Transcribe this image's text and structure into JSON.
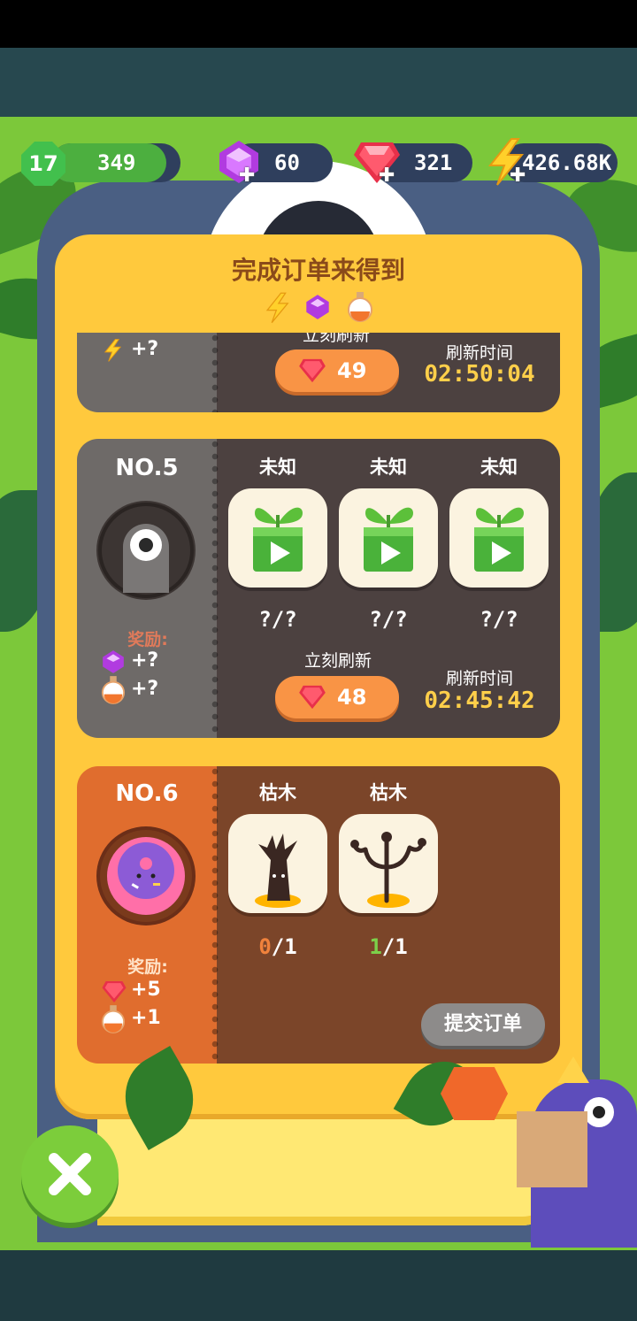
{
  "hud": {
    "level": "17",
    "xp": "349",
    "xp_fraction": 0.78,
    "gems": "60",
    "rubies": "321",
    "energy": "426.68K"
  },
  "panel": {
    "title": "完成订单来得到",
    "title_icons": [
      "lightning-icon",
      "purple-gem-icon",
      "potion-icon"
    ]
  },
  "order4": {
    "reward_value": "+?",
    "refresh_label": "立刻刷新",
    "refresh_cost": "49",
    "time_label": "刷新时间",
    "time_value": "02:50:04"
  },
  "order5": {
    "number": "NO.5",
    "reward_label": "奖励:",
    "rewards": [
      {
        "icon": "purple-gem-icon",
        "value": "+?"
      },
      {
        "icon": "potion-icon",
        "value": "+?"
      }
    ],
    "items": [
      {
        "label": "未知",
        "count": "?/?"
      },
      {
        "label": "未知",
        "count": "?/?"
      },
      {
        "label": "未知",
        "count": "?/?"
      }
    ],
    "refresh_label": "立刻刷新",
    "refresh_cost": "48",
    "time_label": "刷新时间",
    "time_value": "02:45:42"
  },
  "order6": {
    "number": "NO.6",
    "reward_label": "奖励:",
    "rewards": [
      {
        "icon": "ruby-icon",
        "value": "+5"
      },
      {
        "icon": "potion-icon",
        "value": "+1"
      }
    ],
    "items": [
      {
        "label": "枯木",
        "have": "0",
        "need": "/1"
      },
      {
        "label": "枯木",
        "have": "1",
        "need": "/1"
      }
    ],
    "submit_label": "提交订单"
  },
  "colors": {
    "panel": "#ffc93d",
    "accent_orange": "#f99445",
    "time_yellow": "#ffcf4a",
    "count_missing": "#f0823c",
    "count_done": "#7cd04a"
  }
}
